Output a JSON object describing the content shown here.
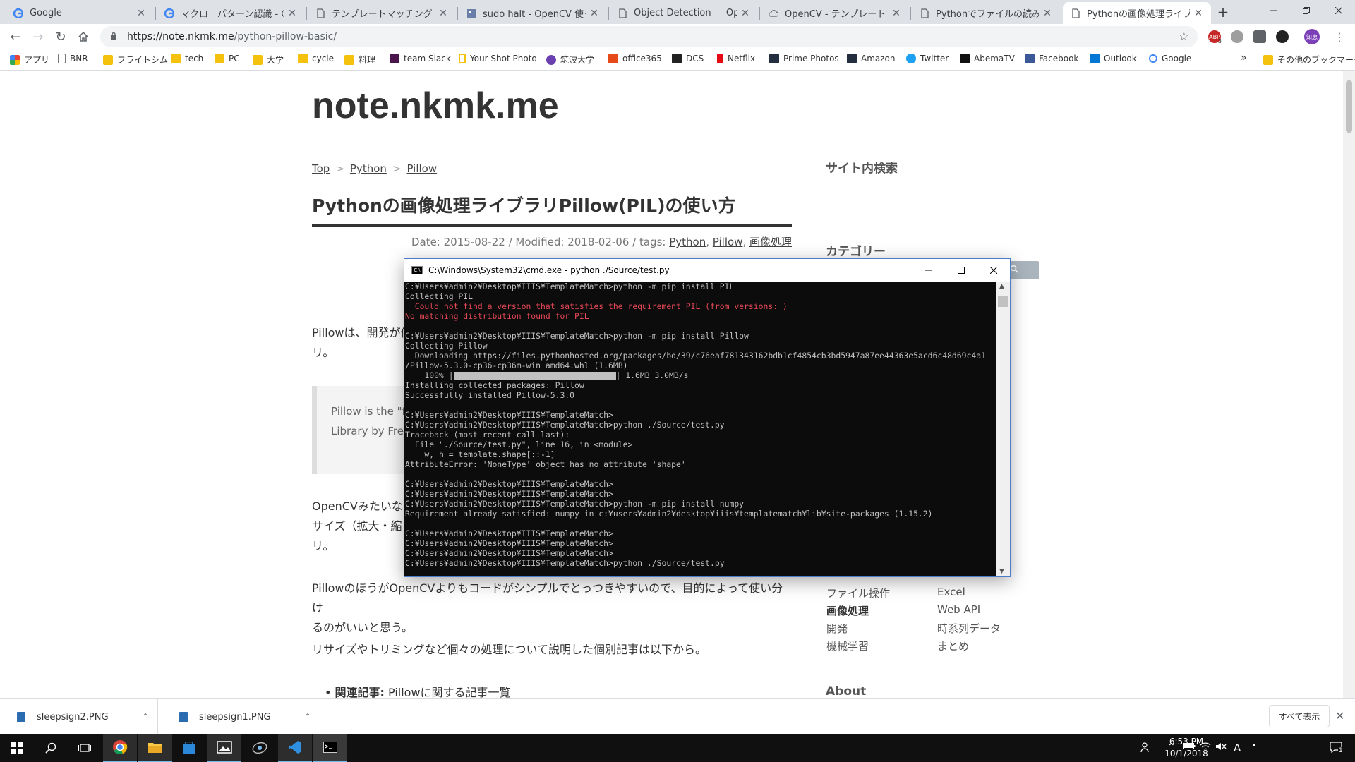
{
  "browser": {
    "tabs": [
      {
        "title": "Google",
        "icon": "google-g-icon"
      },
      {
        "title": "マクロ　パターン認識 - Google",
        "icon": "google-g-icon"
      },
      {
        "title": "テンプレートマッチング — Open",
        "icon": "page-icon"
      },
      {
        "title": "sudo halt - OpenCV 使ってみ",
        "icon": "image-icon"
      },
      {
        "title": "Object Detection — OpenC",
        "icon": "page-icon"
      },
      {
        "title": "OpenCV - テンプレートマッチン",
        "icon": "cloud-icon"
      },
      {
        "title": "Pythonでファイルの読み込み、",
        "icon": "page-icon"
      },
      {
        "title": "Pythonの画像処理ライブラリP",
        "icon": "page-icon"
      }
    ],
    "url": "https://note.nkmk.me/python-pillow-basic/",
    "url_host": "https://note.nkmk.me",
    "url_path": "/python-pillow-basic/",
    "bookmarks": [
      "アプリ",
      "BNR",
      "フライトシム",
      "tech",
      "PC",
      "大学",
      "cycle",
      "料理",
      "team Slack",
      "Your Shot Photo",
      "筑波大学",
      "office365",
      "DCS",
      "Netflix",
      "Prime Photos",
      "Amazon",
      "Twitter",
      "AbemaTV",
      "Facebook",
      "Outlook",
      "Google"
    ],
    "other_bookmarks": "その他のブックマーク",
    "more_chevron": "»",
    "extension_badge": "3",
    "profile_label": "知恵"
  },
  "page": {
    "site_title": "note.nkmk.me",
    "breadcrumb": [
      "Top",
      "Python",
      "Pillow"
    ],
    "breadcrumb_sep": ">",
    "article_title": "Pythonの画像処理ライブラリPillow(PIL)の使い方",
    "meta_prefix": "Date: 2015-08-22 / Modified: 2018-02-06 / tags: ",
    "tags": [
      "Python",
      "Pillow",
      "画像処理"
    ],
    "tag_sep": ", ",
    "para1_a": "Pillowは、開発が停",
    "para1_b": "リ。",
    "quote_a": "Pillow is the \"frie",
    "quote_b": "Library by Fredr",
    "para2_a": "OpenCVみたいな",
    "para2_b": "サイズ（拡大・縮",
    "para2_c": "リ。",
    "para3_a": "PillowのほうがOpenCVよりもコードがシンプルでとっつきやすいので、目的によって使い分け",
    "para3_b": "るのがいいと思う。",
    "para4": "リサイズやトリミングなど個々の処理について説明した個別記事は以下から。",
    "related_label": "関連記事:",
    "related_text": " Pillowに関する記事一覧"
  },
  "sidebar": {
    "search_heading": "サイト内検索",
    "category_heading": "カテゴリー",
    "categories_left": [
      "ファイル操作",
      "画像処理",
      "開発",
      "機械学習"
    ],
    "categories_right": [
      "Excel",
      "Web API",
      "時系列データ",
      "まとめ"
    ],
    "about_heading": "About"
  },
  "cmd": {
    "title": "C:\\Windows\\System32\\cmd.exe - python  ./Source/test.py",
    "lines": [
      {
        "t": "C:¥Users¥admin2¥Desktop¥IIIS¥TemplateMatch>python -m pip install PIL",
        "c": "n"
      },
      {
        "t": "Collecting PIL",
        "c": "n"
      },
      {
        "t": "  Could not find a version that satisfies the requirement PIL (from versions: )",
        "c": "e"
      },
      {
        "t": "No matching distribution found for PIL",
        "c": "e"
      },
      {
        "t": "",
        "c": "n"
      },
      {
        "t": "C:¥Users¥admin2¥Desktop¥IIIS¥TemplateMatch>python -m pip install Pillow",
        "c": "n"
      },
      {
        "t": "Collecting Pillow",
        "c": "n"
      },
      {
        "t": "  Downloading https://files.pythonhosted.org/packages/bd/39/c76eaf781343162bdb1cf4854cb3bd5947a87ee44363e5acd6c48d69c4a1",
        "c": "n"
      },
      {
        "t": "/Pillow-5.3.0-cp36-cp36m-win_amd64.whl (1.6MB)",
        "c": "n"
      }
    ],
    "progress": {
      "percent": "    100% |",
      "tail": "| 1.6MB 3.0MB/s"
    },
    "lines2": [
      {
        "t": "Installing collected packages: Pillow",
        "c": "n"
      },
      {
        "t": "Successfully installed Pillow-5.3.0",
        "c": "n"
      },
      {
        "t": "",
        "c": "n"
      },
      {
        "t": "C:¥Users¥admin2¥Desktop¥IIIS¥TemplateMatch>",
        "c": "n"
      },
      {
        "t": "C:¥Users¥admin2¥Desktop¥IIIS¥TemplateMatch>python ./Source/test.py",
        "c": "n"
      },
      {
        "t": "Traceback (most recent call last):",
        "c": "n"
      },
      {
        "t": "  File \"./Source/test.py\", line 16, in <module>",
        "c": "n"
      },
      {
        "t": "    w, h = template.shape[::-1]",
        "c": "n"
      },
      {
        "t": "AttributeError: 'NoneType' object has no attribute 'shape'",
        "c": "n"
      },
      {
        "t": "",
        "c": "n"
      },
      {
        "t": "C:¥Users¥admin2¥Desktop¥IIIS¥TemplateMatch>",
        "c": "n"
      },
      {
        "t": "C:¥Users¥admin2¥Desktop¥IIIS¥TemplateMatch>",
        "c": "n"
      },
      {
        "t": "C:¥Users¥admin2¥Desktop¥IIIS¥TemplateMatch>python -m pip install numpy",
        "c": "n"
      },
      {
        "t": "Requirement already satisfied: numpy in c:¥users¥admin2¥desktop¥iiis¥templatematch¥lib¥site-packages (1.15.2)",
        "c": "n"
      },
      {
        "t": "",
        "c": "n"
      },
      {
        "t": "C:¥Users¥admin2¥Desktop¥IIIS¥TemplateMatch>",
        "c": "n"
      },
      {
        "t": "C:¥Users¥admin2¥Desktop¥IIIS¥TemplateMatch>",
        "c": "n"
      },
      {
        "t": "C:¥Users¥admin2¥Desktop¥IIIS¥TemplateMatch>",
        "c": "n"
      },
      {
        "t": "C:¥Users¥admin2¥Desktop¥IIIS¥TemplateMatch>python ./Source/test.py",
        "c": "n"
      }
    ]
  },
  "downloads": {
    "items": [
      "sleepsign2.PNG",
      "sleepsign1.PNG"
    ],
    "show_all": "すべて表示"
  },
  "taskbar": {
    "time": "6:53 PM",
    "date": "10/1/2018",
    "ime": "A",
    "notification_count": "1"
  },
  "colors": {
    "error_text": "#e74856",
    "console_bg": "#0c0c0c",
    "console_text": "#c0c0c0",
    "tab_strip": "#dee1e6"
  }
}
